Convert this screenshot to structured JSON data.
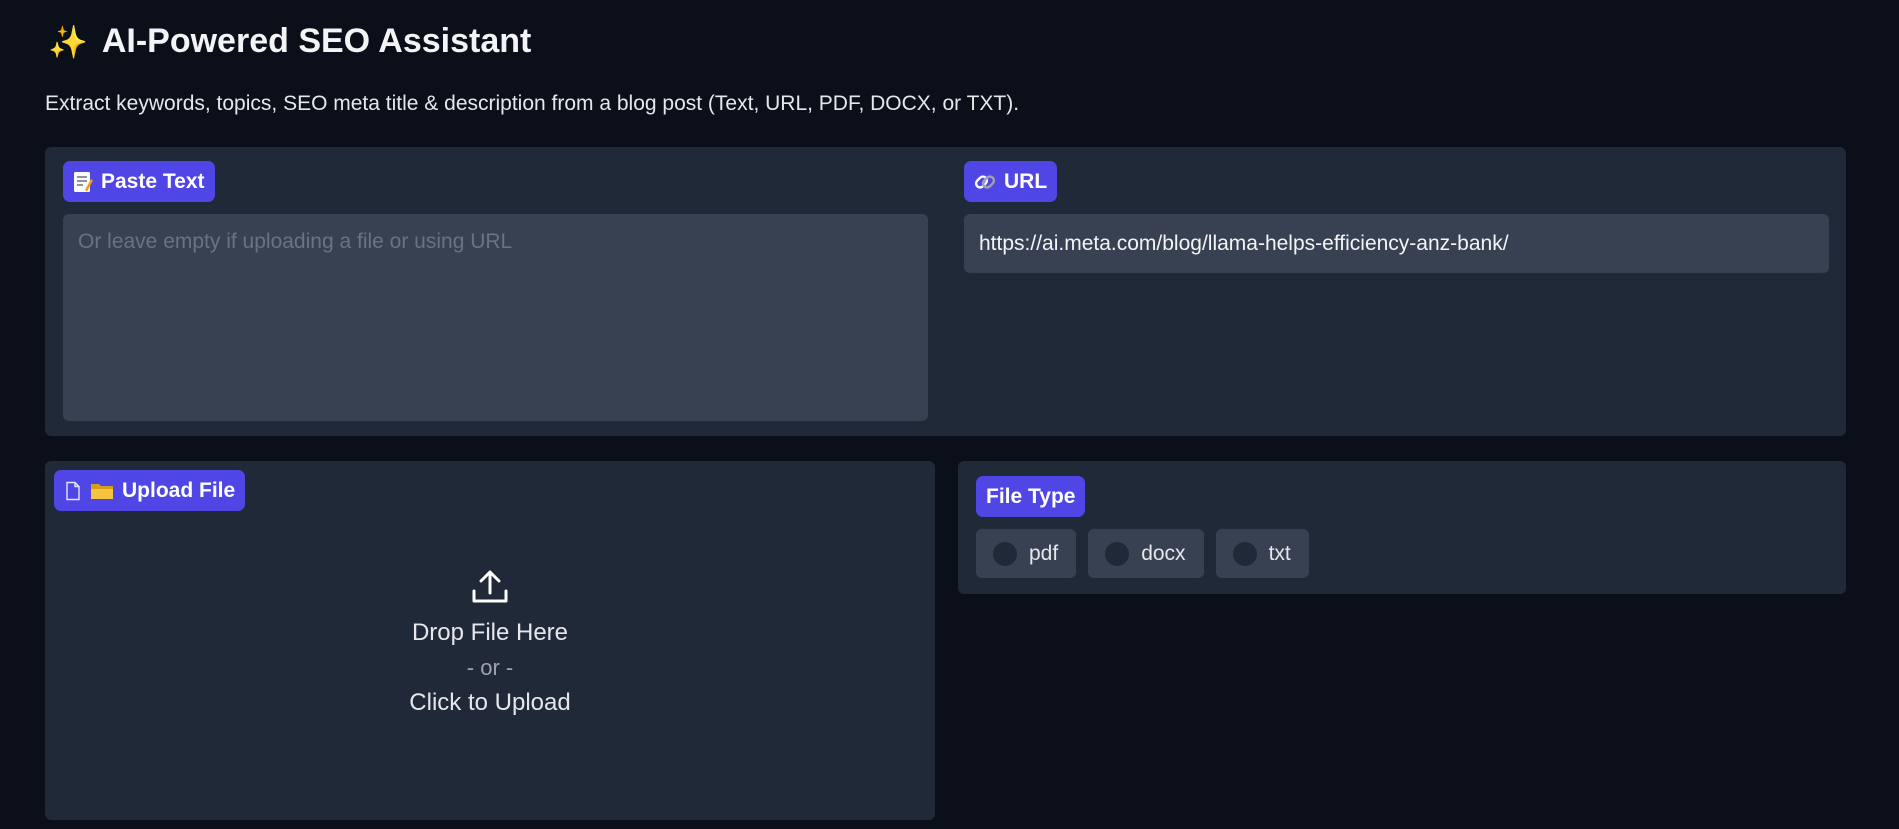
{
  "header": {
    "title": "AI-Powered SEO Assistant",
    "title_icon": "sparkles-icon",
    "description": "Extract keywords, topics, SEO meta title & description from a blog post (Text, URL, PDF, DOCX, or TXT)."
  },
  "paste_text": {
    "label": "Paste Text",
    "icon": "memo-icon",
    "value": "",
    "placeholder": "Or leave empty if uploading a file or using URL"
  },
  "url": {
    "label": "URL",
    "icon": "link-icon",
    "value": "https://ai.meta.com/blog/llama-helps-efficiency-anz-bank/"
  },
  "upload": {
    "label": "Upload File",
    "icons": [
      "file-icon",
      "folder-icon"
    ],
    "drop_text": "Drop File Here",
    "or_text": "- or -",
    "click_text": "Click to Upload"
  },
  "file_type": {
    "label": "File Type",
    "options": [
      "pdf",
      "docx",
      "txt"
    ],
    "selected": null
  },
  "colors": {
    "background": "#0b0f19",
    "panel": "#1f2937",
    "input": "#374151",
    "accent": "#4f46e5"
  }
}
